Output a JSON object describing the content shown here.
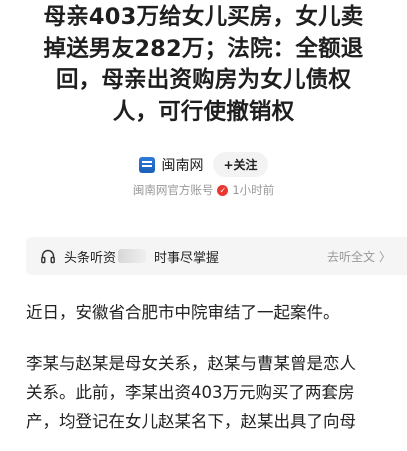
{
  "article": {
    "title_lines": [
      "母亲403万给女儿买房，女儿卖",
      "掉送男友282万；法院：全额退",
      "回，母亲出资购房为女儿债权",
      "人，可行使撤销权"
    ],
    "source": {
      "name": "闽南网",
      "follow_label": "+关注",
      "account_type": "闽南网官方账号",
      "time": "1小时前"
    },
    "listen_bar": {
      "label_prefix": "头条听资",
      "label_suffix": "时事尽掌握",
      "action_label": "去听全文"
    },
    "paragraphs": [
      {
        "lines": [
          "近日，安徽省合肥市中院审结了一起案件。"
        ]
      },
      {
        "lines": [
          "李某与赵某是母女关系，赵某与曹某曾是恋人",
          "关系。此前，李某出资403万元购买了两套房",
          "产，均登记在女儿赵某名下，赵某出具了向母"
        ]
      }
    ]
  },
  "colors": {
    "verify_badge": "#e8382f",
    "logo_blue": "#2f7bd8",
    "meta_gray": "#999999"
  },
  "icons": {
    "source_logo": "news-logo-icon",
    "verified": "verified-badge-icon",
    "listen": "headphone-icon",
    "chevron": "chevron-right-icon"
  }
}
